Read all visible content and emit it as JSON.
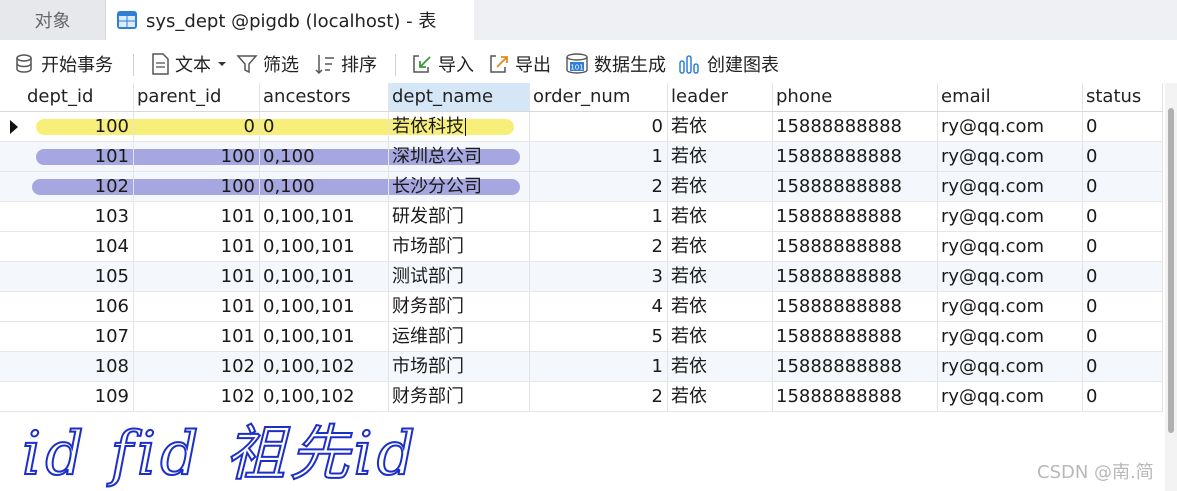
{
  "tabs": [
    {
      "label": "对象",
      "active": false
    },
    {
      "label": "sys_dept @pigdb (localhost) - 表",
      "active": true
    }
  ],
  "toolbar": {
    "begin_transaction": "开始事务",
    "text": "文本",
    "filter": "筛选",
    "sort": "排序",
    "import": "导入",
    "export": "导出",
    "generate_data": "数据生成",
    "create_chart": "创建图表"
  },
  "colors": {
    "highlight_yellow": "#f7ef79",
    "highlight_purple": "#a6a6e0",
    "selected_header": "#d5e6f6",
    "handwriting": "#1d2fc9"
  },
  "table": {
    "selected_column": "dept_name",
    "columns": [
      "dept_id",
      "parent_id",
      "ancestors",
      "dept_name",
      "order_num",
      "leader",
      "phone",
      "email",
      "status"
    ],
    "rows": [
      [
        "100",
        "0",
        "0",
        "若依科技",
        "0",
        "若依",
        "15888888888",
        "ry@qq.com",
        "0"
      ],
      [
        "101",
        "100",
        "0,100",
        "深圳总公司",
        "1",
        "若依",
        "15888888888",
        "ry@qq.com",
        "0"
      ],
      [
        "102",
        "100",
        "0,100",
        "长沙分公司",
        "2",
        "若依",
        "15888888888",
        "ry@qq.com",
        "0"
      ],
      [
        "103",
        "101",
        "0,100,101",
        "研发部门",
        "1",
        "若依",
        "15888888888",
        "ry@qq.com",
        "0"
      ],
      [
        "104",
        "101",
        "0,100,101",
        "市场部门",
        "2",
        "若依",
        "15888888888",
        "ry@qq.com",
        "0"
      ],
      [
        "105",
        "101",
        "0,100,101",
        "测试部门",
        "3",
        "若依",
        "15888888888",
        "ry@qq.com",
        "0"
      ],
      [
        "106",
        "101",
        "0,100,101",
        "财务部门",
        "4",
        "若依",
        "15888888888",
        "ry@qq.com",
        "0"
      ],
      [
        "107",
        "101",
        "0,100,101",
        "运维部门",
        "5",
        "若依",
        "15888888888",
        "ry@qq.com",
        "0"
      ],
      [
        "108",
        "102",
        "0,100,102",
        "市场部门",
        "1",
        "若依",
        "15888888888",
        "ry@qq.com",
        "0"
      ],
      [
        "109",
        "102",
        "0,100,102",
        "财务部门",
        "2",
        "若依",
        "15888888888",
        "ry@qq.com",
        "0"
      ]
    ],
    "current_row": 0,
    "highlighted_rows": [
      {
        "row": 0,
        "color": "yellow"
      },
      {
        "row": 1,
        "color": "purple"
      },
      {
        "row": 2,
        "color": "purple"
      }
    ]
  },
  "annotation": {
    "handwritten_text": "id  fid  祖先id"
  },
  "watermark": "CSDN @南.简"
}
